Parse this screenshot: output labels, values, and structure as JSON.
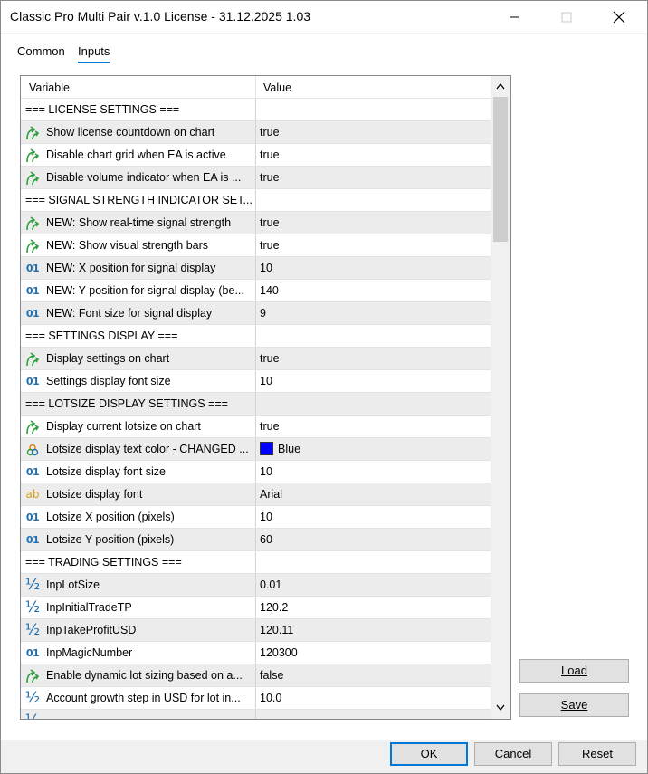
{
  "window": {
    "title": "Classic Pro Multi Pair v.1.0 License - 31.12.2025 1.03"
  },
  "tabs": [
    {
      "label": "Common"
    },
    {
      "label": "Inputs"
    }
  ],
  "grid": {
    "headers": {
      "variable": "Variable",
      "value": "Value"
    },
    "rows": [
      {
        "type": "section",
        "icon": "",
        "label": "=== LICENSE SETTINGS ===",
        "value": ""
      },
      {
        "type": "bool",
        "icon": "bool-arrow-icon",
        "label": "Show license countdown on chart",
        "value": "true"
      },
      {
        "type": "bool",
        "icon": "bool-arrow-icon",
        "label": "Disable chart grid when EA is active",
        "value": "true"
      },
      {
        "type": "bool",
        "icon": "bool-arrow-icon",
        "label": "Disable volume indicator when EA is ...",
        "value": "true"
      },
      {
        "type": "section",
        "icon": "",
        "label": "=== SIGNAL STRENGTH INDICATOR SET...",
        "value": ""
      },
      {
        "type": "bool",
        "icon": "bool-arrow-icon",
        "label": "NEW: Show real-time signal strength",
        "value": "true"
      },
      {
        "type": "bool",
        "icon": "bool-arrow-icon",
        "label": "NEW: Show visual strength bars",
        "value": "true"
      },
      {
        "type": "int",
        "icon": "integer-icon",
        "label": "NEW: X position for signal display",
        "value": "10"
      },
      {
        "type": "int",
        "icon": "integer-icon",
        "label": "NEW: Y position for signal display (be...",
        "value": "140"
      },
      {
        "type": "int",
        "icon": "integer-icon",
        "label": "NEW: Font size for signal display",
        "value": "9"
      },
      {
        "type": "section",
        "icon": "",
        "label": "=== SETTINGS DISPLAY ===",
        "value": ""
      },
      {
        "type": "bool",
        "icon": "bool-arrow-icon",
        "label": "Display settings on chart",
        "value": "true"
      },
      {
        "type": "int",
        "icon": "integer-icon",
        "label": "Settings display font size",
        "value": "10"
      },
      {
        "type": "section",
        "icon": "",
        "label": "=== LOTSIZE DISPLAY SETTINGS ===",
        "value": ""
      },
      {
        "type": "bool",
        "icon": "bool-arrow-icon",
        "label": "Display current lotsize on chart",
        "value": "true"
      },
      {
        "type": "color",
        "icon": "color-palette-icon",
        "label": "Lotsize display text color - CHANGED ...",
        "value": "Blue"
      },
      {
        "type": "int",
        "icon": "integer-icon",
        "label": "Lotsize display font size",
        "value": "10"
      },
      {
        "type": "string",
        "icon": "string-icon",
        "label": "Lotsize display font",
        "value": "Arial"
      },
      {
        "type": "int",
        "icon": "integer-icon",
        "label": "Lotsize X position (pixels)",
        "value": "10"
      },
      {
        "type": "int",
        "icon": "integer-icon",
        "label": "Lotsize Y position (pixels)",
        "value": "60"
      },
      {
        "type": "section",
        "icon": "",
        "label": "=== TRADING SETTINGS ===",
        "value": ""
      },
      {
        "type": "double",
        "icon": "double-fraction-icon",
        "label": "InpLotSize",
        "value": "0.01"
      },
      {
        "type": "double",
        "icon": "double-fraction-icon",
        "label": "InpInitialTradeTP",
        "value": "120.2"
      },
      {
        "type": "double",
        "icon": "double-fraction-icon",
        "label": "InpTakeProfitUSD",
        "value": "120.11"
      },
      {
        "type": "int",
        "icon": "integer-icon",
        "label": "InpMagicNumber",
        "value": "120300"
      },
      {
        "type": "bool",
        "icon": "bool-arrow-icon",
        "label": "Enable dynamic lot sizing based on a...",
        "value": "false"
      },
      {
        "type": "double",
        "icon": "double-fraction-icon",
        "label": "Account growth step in USD for lot in...",
        "value": "10.0"
      },
      {
        "type": "double",
        "icon": "double-fraction-icon",
        "label": "",
        "value": ""
      }
    ]
  },
  "icon_glyphs": {
    "integer": "01",
    "string": "ab",
    "double": "½"
  },
  "colors": {
    "accent": "#0078d7",
    "bool_icon": "#2e9e3e",
    "swatch_blue": "#0000ff"
  },
  "buttons": {
    "load": "Load",
    "save": "Save",
    "ok": "OK",
    "cancel": "Cancel",
    "reset": "Reset"
  }
}
